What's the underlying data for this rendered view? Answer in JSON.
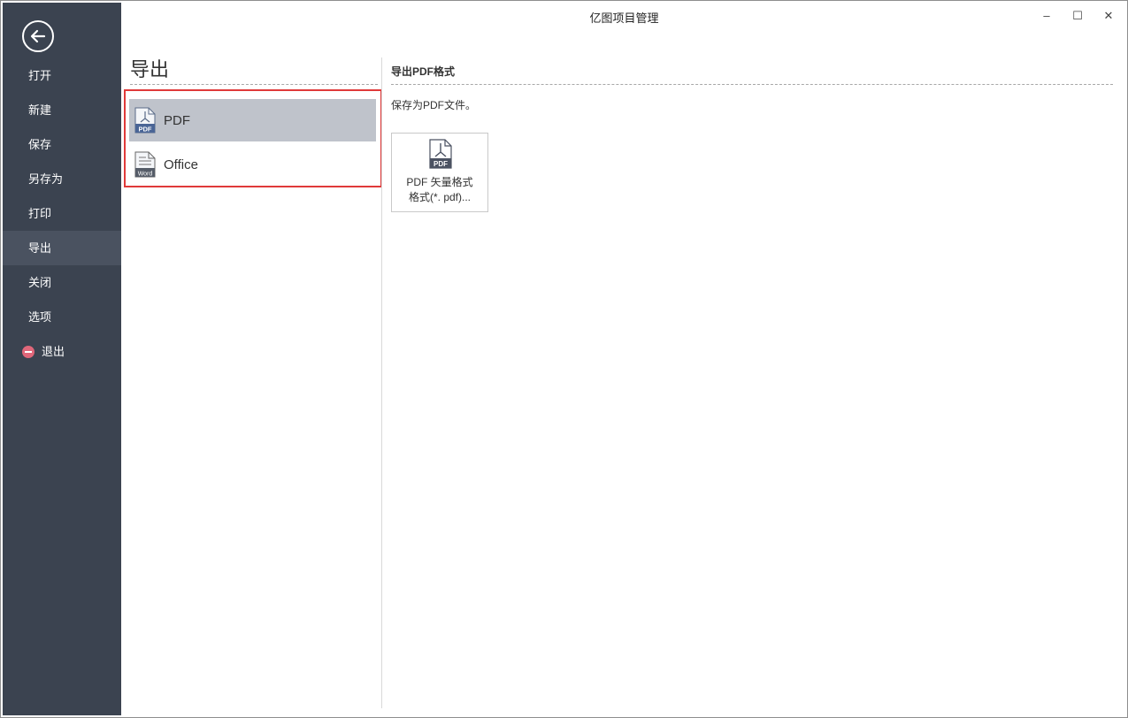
{
  "window": {
    "title": "亿图项目管理"
  },
  "window_controls": {
    "minimize": "–",
    "maximize": "☐",
    "close": "✕"
  },
  "sidebar": {
    "back_icon": "back-arrow-icon",
    "items": [
      {
        "label": "打开"
      },
      {
        "label": "新建"
      },
      {
        "label": "保存"
      },
      {
        "label": "另存为"
      },
      {
        "label": "打印"
      },
      {
        "label": "导出",
        "active": true
      },
      {
        "label": "关闭"
      },
      {
        "label": "选项"
      },
      {
        "label": "退出",
        "icon": "exit-icon"
      }
    ]
  },
  "export_panel": {
    "title": "导出",
    "options": [
      {
        "label": "PDF",
        "icon": "pdf-file-icon",
        "selected": true
      },
      {
        "label": "Office",
        "icon": "word-file-icon"
      }
    ]
  },
  "detail": {
    "title": "导出PDF格式",
    "description": "保存为PDF文件。",
    "card": {
      "line1": "PDF 矢量格式",
      "line2": "格式(*. pdf)...",
      "icon": "pdf-file-icon",
      "icon_text": "PDF"
    }
  },
  "colors": {
    "sidebar_bg": "#3b4350",
    "sidebar_active": "#4a5260",
    "selected_option": "#bfc3cb",
    "highlight_border": "#e03a3a",
    "exit_icon": "#e0677a"
  }
}
